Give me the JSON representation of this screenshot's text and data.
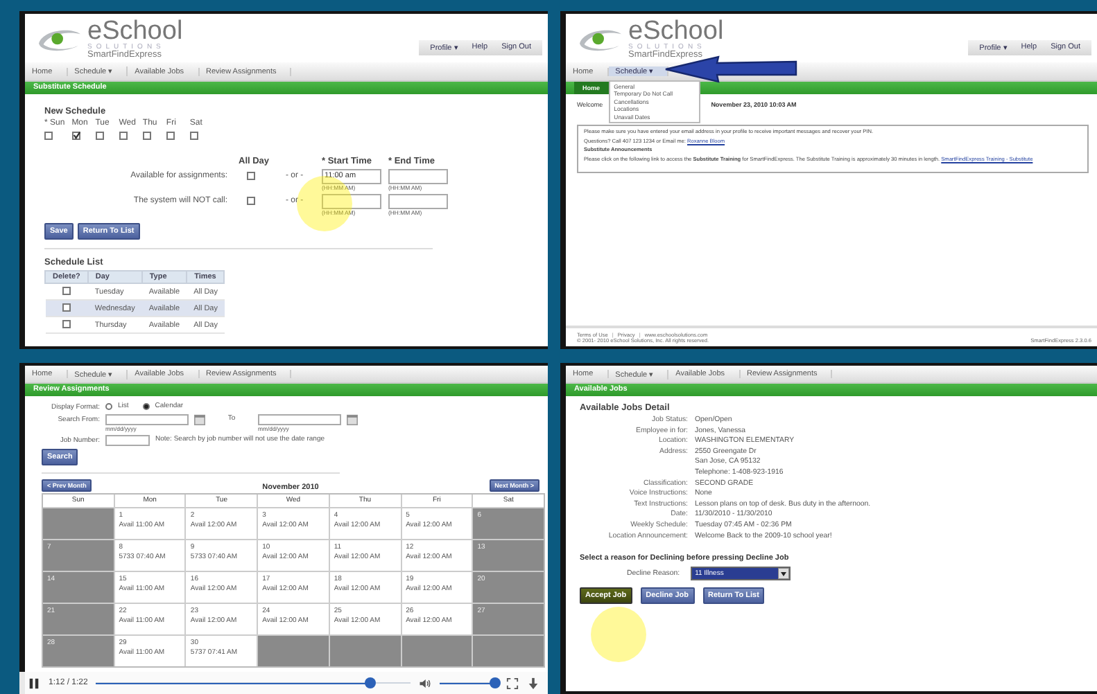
{
  "schedule_screen": {
    "logo": {
      "name": "eSchool",
      "sub": "SOLUTIONS",
      "product": "SmartFindExpress"
    },
    "top_links": [
      "Profile ▾",
      "Help",
      "Sign Out"
    ],
    "nav": [
      {
        "label": "Home"
      },
      {
        "label": "Schedule ▾"
      },
      {
        "label": "Available Jobs"
      },
      {
        "label": "Review Assignments"
      }
    ],
    "page_title": "Substitute Schedule",
    "section_title": "New Schedule",
    "days": [
      {
        "label": "* Sun",
        "checked": false
      },
      {
        "label": "Mon",
        "checked": true
      },
      {
        "label": "Tue",
        "checked": false
      },
      {
        "label": "Wed",
        "checked": false
      },
      {
        "label": "Thu",
        "checked": false
      },
      {
        "label": "Fri",
        "checked": false
      },
      {
        "label": "Sat",
        "checked": false
      }
    ],
    "column_headers": {
      "all_day": "All Day",
      "start": "* Start Time",
      "end": "* End Time"
    },
    "rows": [
      {
        "label": "Available for assignments:",
        "all_day": false,
        "separator": "- or -",
        "start_value": "11:00 am",
        "start_hint": "(HH:MM AM)",
        "end_hint": "(HH:MM AM)"
      },
      {
        "label": "The system will NOT call:",
        "all_day": false,
        "separator": "- or -",
        "start_value": "",
        "start_hint": "(HH:MM AM)",
        "end_hint": "(HH:MM AM)"
      }
    ],
    "buttons": [
      "Save",
      "Return To List"
    ],
    "list_title": "Schedule List",
    "list_columns": [
      "Delete?",
      "Day",
      "Type",
      "Times"
    ],
    "list_rows": [
      {
        "delete": false,
        "day": "Tuesday",
        "type": "Available",
        "times": "All Day",
        "selected": false
      },
      {
        "delete": false,
        "day": "Wednesday",
        "type": "Available",
        "times": "All Day",
        "selected": true
      },
      {
        "delete": false,
        "day": "Thursday",
        "type": "Available",
        "times": "All Day",
        "selected": false
      }
    ]
  },
  "home_screen": {
    "logo": {
      "name": "eSchool",
      "sub": "SOLUTIONS",
      "product": "SmartFindExpress"
    },
    "top_links": [
      "Profile ▾",
      "Help",
      "Sign Out"
    ],
    "nav": [
      {
        "label": "Home"
      },
      {
        "label": "Schedule ▾",
        "menu": [
          "General",
          "Temporary Do Not Call",
          "Cancellations",
          "Locations",
          "Unavail Dates"
        ]
      }
    ],
    "page_tab": "Home",
    "welcome": "Welcome",
    "date": "November 23, 2010 10:03 AM",
    "notice": "Please make sure you have entered your email address in your profile to receive important messages and recover your PIN.",
    "questions": "Questions? Call 407 123 1234 or Email me:",
    "contact_link": "Roxanne Bloom",
    "announcement_title": "Substitute Announcements",
    "announcement": "Please click on the following link to access the **Substitute Training** for SmartFindExpress. The Substitute Training is approximately 30 minutes in length.",
    "training_link": "SmartFindExpress Training - Substitute",
    "footer_links": [
      {
        "kind": "link",
        "text": "Terms of Use"
      },
      {
        "kind": "separator",
        "text": "|"
      },
      {
        "kind": "link",
        "text": "Privacy"
      },
      {
        "kind": "separator",
        "text": "|"
      },
      {
        "kind": "link",
        "text": "www.eschoolsolutions.com"
      }
    ],
    "copyright": "© 2001- 2010 eSchool Solutions, Inc. All rights reserved.",
    "version": "SmartFindExpress 2.3.0.6"
  },
  "calendar_screen": {
    "nav": [
      {
        "label": "Home"
      },
      {
        "label": "Schedule ▾"
      },
      {
        "label": "Available Jobs"
      },
      {
        "label": "Review Assignments"
      }
    ],
    "page_title": "Review Assignments",
    "format_label": "Display Format:",
    "formats": [
      {
        "label": "List",
        "selected": false
      },
      {
        "label": "Calendar",
        "selected": true
      }
    ],
    "from_label": "Search From:",
    "from_hint": "mm/dd/yyyy",
    "to_label": "To",
    "to_hint": "mm/dd/yyyy",
    "job_label": "Job Number:",
    "job_note": "Note: Search by job number will not use the date range",
    "search_button": "Search",
    "prev_button": "< Prev Month",
    "next_button": "Next Month >",
    "month": "November 2010",
    "weekdays": [
      "Sun",
      "Mon",
      "Tue",
      "Wed",
      "Thu",
      "Fri",
      "Sat"
    ],
    "weeks": [
      [
        {
          "kind": "closed"
        },
        {
          "kind": "open",
          "day": "1",
          "text": "Avail 11:00 AM"
        },
        {
          "kind": "open",
          "day": "2",
          "text": "Avail 12:00 AM"
        },
        {
          "kind": "open",
          "day": "3",
          "text": "Avail 12:00 AM"
        },
        {
          "kind": "open",
          "day": "4",
          "text": "Avail 12:00 AM"
        },
        {
          "kind": "open",
          "day": "5",
          "text": "Avail 12:00 AM"
        },
        {
          "kind": "closed",
          "day": "6"
        }
      ],
      [
        {
          "kind": "closed",
          "day": "7"
        },
        {
          "kind": "open",
          "day": "8",
          "text": "5733 07:40 AM"
        },
        {
          "kind": "open",
          "day": "9",
          "text": "5733 07:40 AM"
        },
        {
          "kind": "open",
          "day": "10",
          "text": "Avail 12:00 AM"
        },
        {
          "kind": "open",
          "day": "11",
          "text": "Avail 12:00 AM"
        },
        {
          "kind": "open",
          "day": "12",
          "text": "Avail 12:00 AM"
        },
        {
          "kind": "closed",
          "day": "13"
        }
      ],
      [
        {
          "kind": "closed",
          "day": "14"
        },
        {
          "kind": "open",
          "day": "15",
          "text": "Avail 11:00 AM"
        },
        {
          "kind": "open",
          "day": "16",
          "text": "Avail 12:00 AM"
        },
        {
          "kind": "open",
          "day": "17",
          "text": "Avail 12:00 AM"
        },
        {
          "kind": "open",
          "day": "18",
          "text": "Avail 12:00 AM"
        },
        {
          "kind": "open",
          "day": "19",
          "text": "Avail 12:00 AM"
        },
        {
          "kind": "closed",
          "day": "20"
        }
      ],
      [
        {
          "kind": "closed",
          "day": "21"
        },
        {
          "kind": "open",
          "day": "22",
          "text": "Avail 11:00 AM"
        },
        {
          "kind": "open",
          "day": "23",
          "text": "Avail 12:00 AM"
        },
        {
          "kind": "open",
          "day": "24",
          "text": "Avail 12:00 AM"
        },
        {
          "kind": "open",
          "day": "25",
          "text": "Avail 12:00 AM"
        },
        {
          "kind": "open",
          "day": "26",
          "text": "Avail 12:00 AM"
        },
        {
          "kind": "closed",
          "day": "27"
        }
      ],
      [
        {
          "kind": "closed",
          "day": "28"
        },
        {
          "kind": "open",
          "day": "29",
          "text": "Avail 11:00 AM"
        },
        {
          "kind": "open",
          "day": "30",
          "text": "5737 07:41 AM"
        },
        {
          "kind": "closed"
        },
        {
          "kind": "closed"
        },
        {
          "kind": "closed"
        },
        {
          "kind": "closed"
        }
      ]
    ]
  },
  "job_detail_screen": {
    "nav": [
      {
        "label": "Home"
      },
      {
        "label": "Schedule ▾"
      },
      {
        "label": "Available Jobs"
      },
      {
        "label": "Review Assignments"
      }
    ],
    "page_title": "Available Jobs",
    "section_title": "Available Jobs Detail",
    "fields": [
      {
        "label": "Job Status:",
        "lines": [
          "Open/Open"
        ]
      },
      {
        "label": "Employee in for:",
        "lines": [
          "Jones, Vanessa"
        ]
      },
      {
        "label": "Location:",
        "lines": [
          "WASHINGTON ELEMENTARY"
        ]
      },
      {
        "label": "Address:",
        "lines": [
          "2550 Greengate Dr",
          "San Jose, CA 95132",
          "Telephone: 1-408-923-1916"
        ]
      },
      {
        "label": "Classification:",
        "lines": [
          "SECOND GRADE"
        ]
      },
      {
        "label": "Voice Instructions:",
        "lines": [
          "None"
        ]
      },
      {
        "label": "Text Instructions:",
        "lines": [
          "Lesson plans on top of desk. Bus duty in the afternoon."
        ]
      },
      {
        "label": "Date:",
        "lines": [
          "11/30/2010 - 11/30/2010"
        ]
      },
      {
        "label": "Weekly Schedule:",
        "lines": [
          "Tuesday 07:45 AM - 02:36 PM"
        ]
      },
      {
        "label": "Location Announcement:",
        "lines": [
          "Welcome Back to the 2009-10 school year!"
        ]
      }
    ],
    "decline_prompt": "Select a reason for Declining before pressing Decline Job",
    "decline_label": "Decline Reason:",
    "decline_value": "11 Illness",
    "buttons": [
      {
        "label": "Accept Job",
        "kind": "accept"
      },
      {
        "label": "Decline Job",
        "kind": "normal"
      },
      {
        "label": "Return To List",
        "kind": "normal"
      }
    ]
  },
  "video_player": {
    "playing": true,
    "time": "1:12 / 1:22",
    "progress": {
      "level": 0.87
    },
    "volume": {
      "level": 0.95
    }
  }
}
